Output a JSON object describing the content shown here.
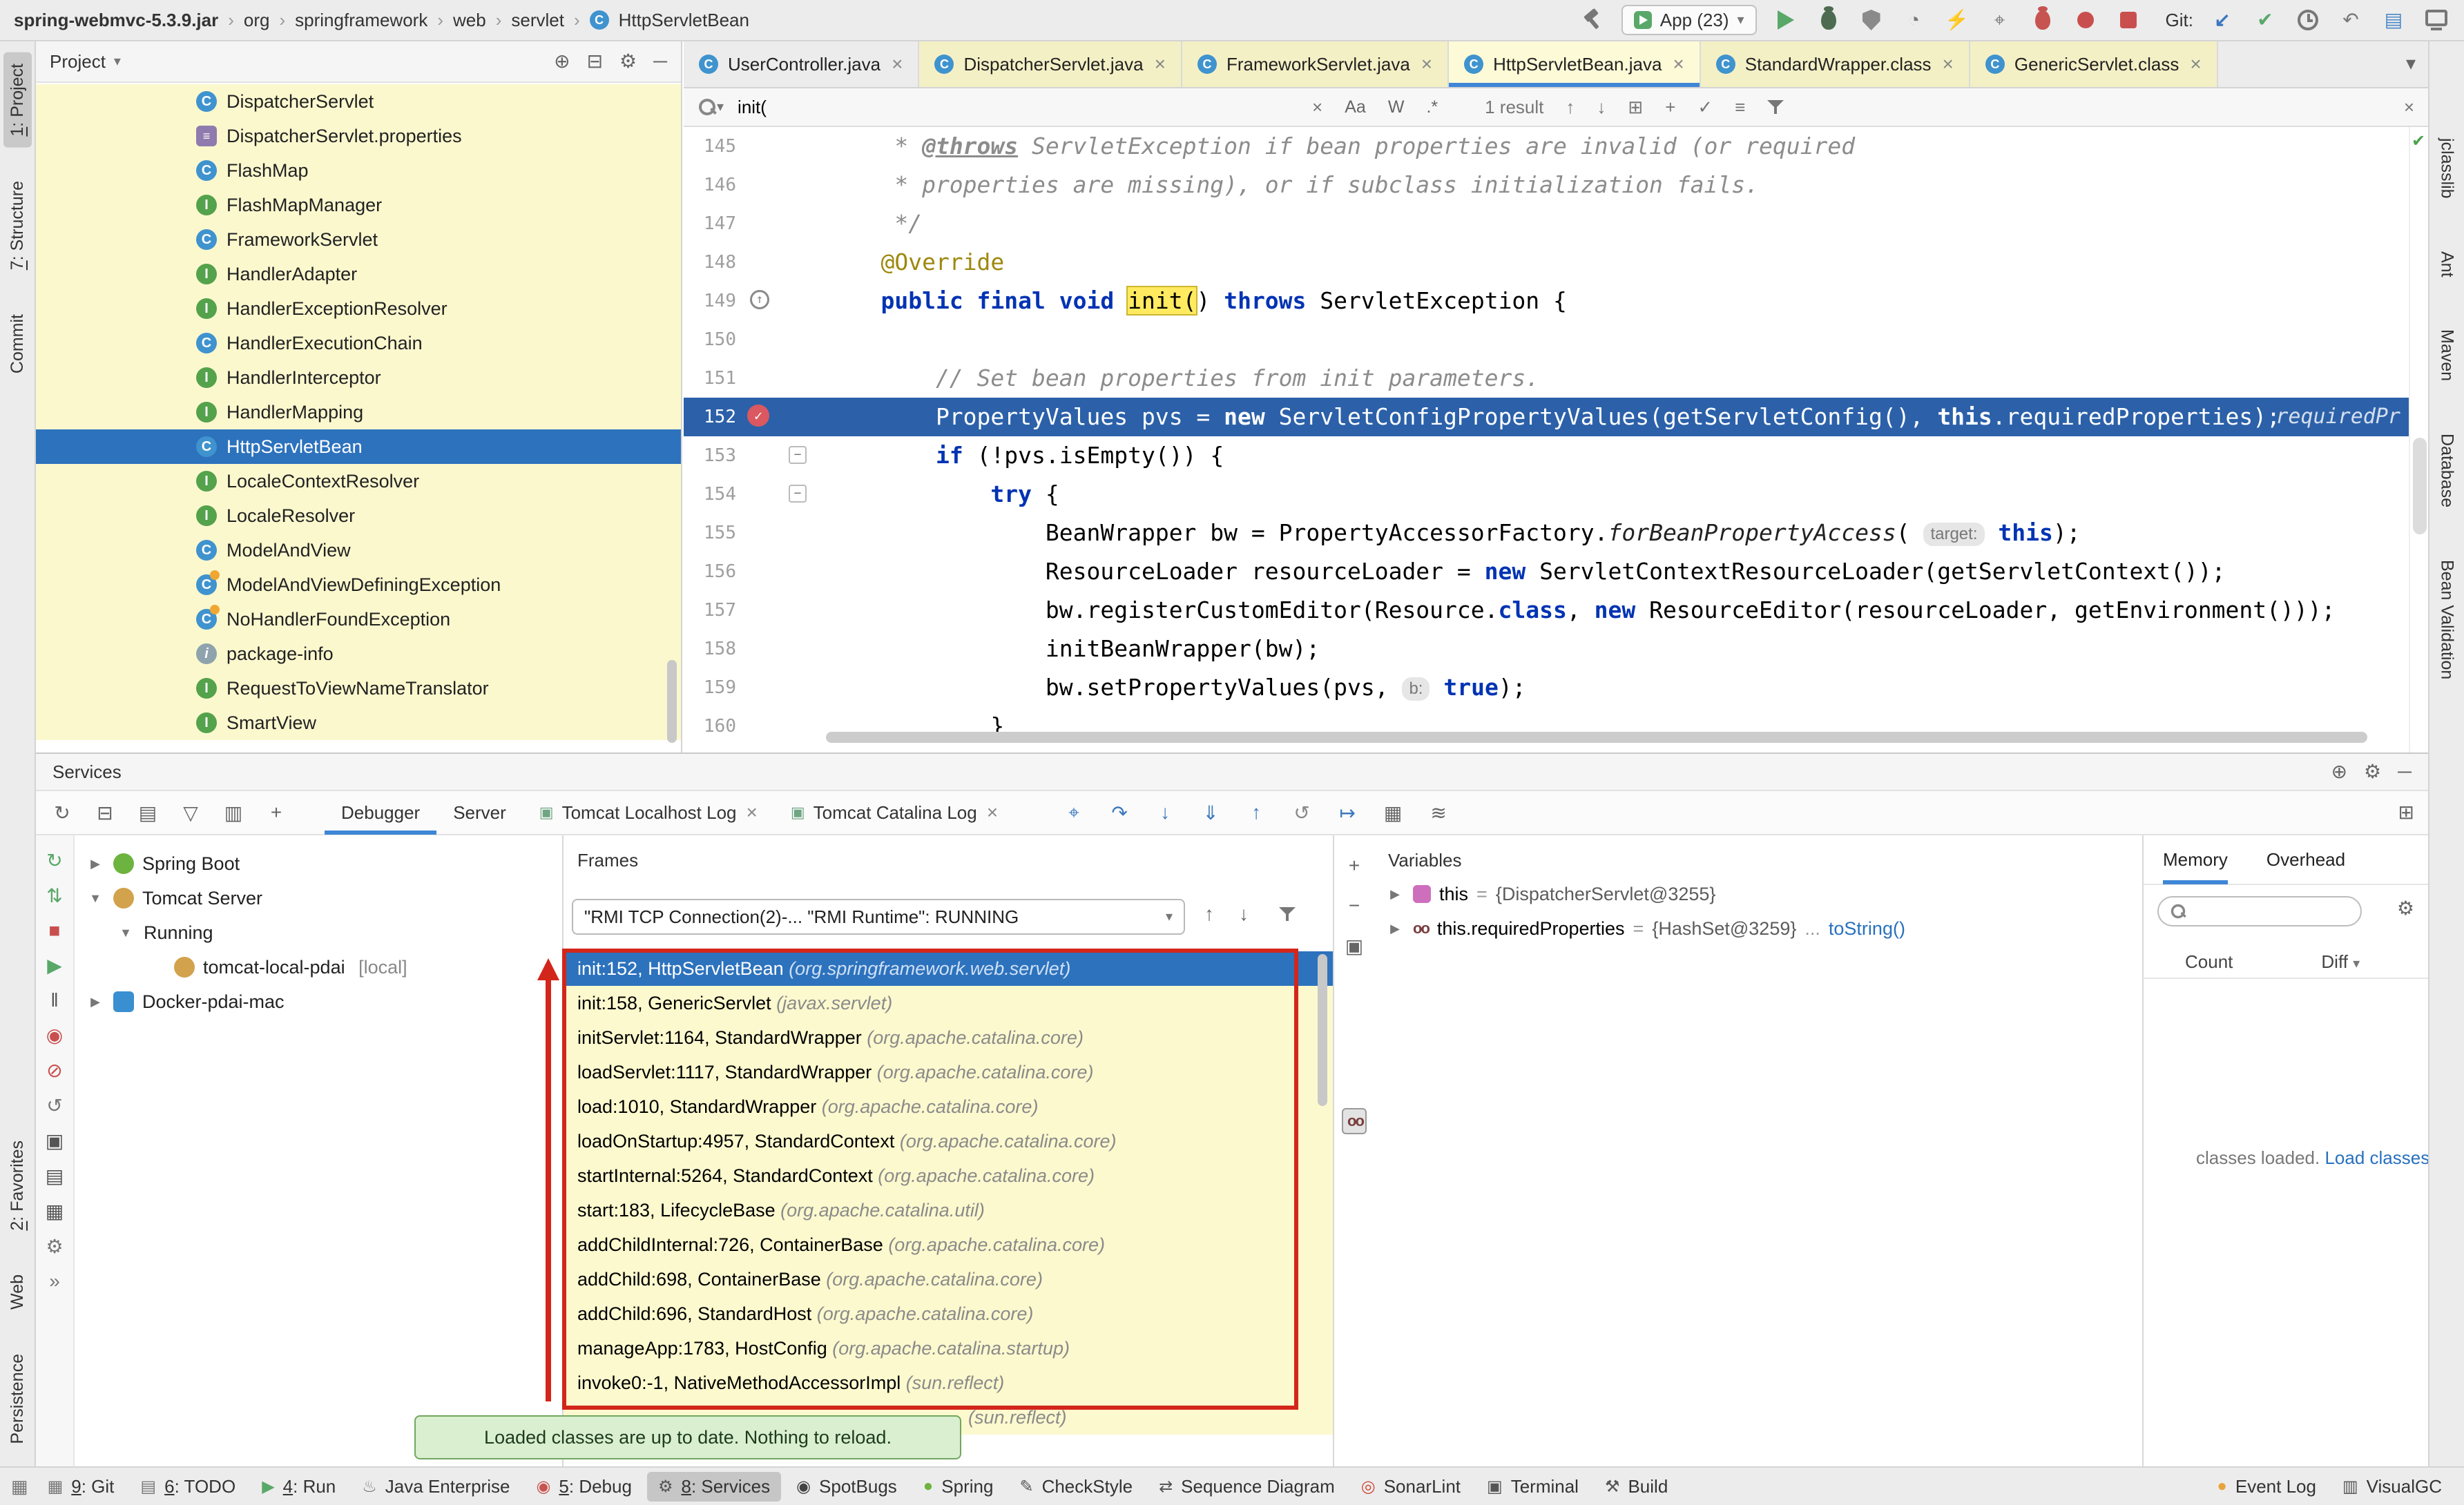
{
  "titlebar": {
    "breadcrumbs": [
      "spring-webmvc-5.3.9.jar",
      "org",
      "springframework",
      "web",
      "servlet",
      "HttpServletBean"
    ],
    "run_config_label": "App (23)",
    "git_label": "Git:"
  },
  "left_strip": {
    "top": [
      {
        "label": "1: Project",
        "active": true
      },
      {
        "label": "7: Structure"
      },
      {
        "label": "Commit"
      }
    ],
    "bottom": [
      {
        "label": "2: Favorites"
      },
      {
        "label": "Web"
      },
      {
        "label": "Persistence"
      }
    ]
  },
  "right_strip": [
    "jclasslib",
    "Ant",
    "Maven",
    "Database",
    "Bean Validation"
  ],
  "project_panel": {
    "title": "Project",
    "items": [
      {
        "label": "DispatcherServlet",
        "icon": "class"
      },
      {
        "label": "DispatcherServlet.properties",
        "icon": "properties"
      },
      {
        "label": "FlashMap",
        "icon": "class"
      },
      {
        "label": "FlashMapManager",
        "icon": "interface"
      },
      {
        "label": "FrameworkServlet",
        "icon": "class"
      },
      {
        "label": "HandlerAdapter",
        "icon": "interface"
      },
      {
        "label": "HandlerExceptionResolver",
        "icon": "interface"
      },
      {
        "label": "HandlerExecutionChain",
        "icon": "class"
      },
      {
        "label": "HandlerInterceptor",
        "icon": "interface"
      },
      {
        "label": "HandlerMapping",
        "icon": "interface"
      },
      {
        "label": "HttpServletBean",
        "icon": "class",
        "selected": true
      },
      {
        "label": "LocaleContextResolver",
        "icon": "interface"
      },
      {
        "label": "LocaleResolver",
        "icon": "interface"
      },
      {
        "label": "ModelAndView",
        "icon": "class"
      },
      {
        "label": "ModelAndViewDefiningException",
        "icon": "exception"
      },
      {
        "label": "NoHandlerFoundException",
        "icon": "exception"
      },
      {
        "label": "package-info",
        "icon": "package-info"
      },
      {
        "label": "RequestToViewNameTranslator",
        "icon": "interface"
      },
      {
        "label": "SmartView",
        "icon": "interface"
      }
    ]
  },
  "editor": {
    "tabs": [
      {
        "label": "UserController.java",
        "kind": "plain"
      },
      {
        "label": "DispatcherServlet.java",
        "kind": "lib"
      },
      {
        "label": "FrameworkServlet.java",
        "kind": "lib"
      },
      {
        "label": "HttpServletBean.java",
        "kind": "lib",
        "active": true
      },
      {
        "label": "StandardWrapper.class",
        "kind": "lib"
      },
      {
        "label": "GenericServlet.class",
        "kind": "lib"
      }
    ],
    "find": {
      "query": "init(",
      "match_case": "Aa",
      "words": "W",
      "regex": ".*",
      "results": "1 result"
    },
    "code": {
      "lines": [
        {
          "num": 145,
          "segs": [
            [
              "doc",
              "     * "
            ],
            [
              "doctag",
              "@throws"
            ],
            [
              "doc",
              " ServletException if bean properties are invalid (or required"
            ]
          ]
        },
        {
          "num": 146,
          "segs": [
            [
              "doc",
              "     * properties are missing), or if subclass initialization fails."
            ]
          ]
        },
        {
          "num": 147,
          "segs": [
            [
              "doc",
              "     */"
            ]
          ]
        },
        {
          "num": 148,
          "segs": [
            [
              "ann",
              "    @Override"
            ]
          ]
        },
        {
          "num": 149,
          "gutter": "override",
          "segs": [
            [
              "pl",
              "    "
            ],
            [
              "kw",
              "public final void "
            ],
            [
              "hl",
              "init("
            ],
            [
              "pl",
              ") "
            ],
            [
              "kw",
              "throws"
            ],
            [
              "pl",
              " ServletException {"
            ]
          ]
        },
        {
          "num": 150,
          "segs": []
        },
        {
          "num": 151,
          "segs": [
            [
              "cmt",
              "        // Set bean properties from init parameters."
            ]
          ]
        },
        {
          "num": 152,
          "exec": true,
          "gutter": "breakpoint",
          "hint_right": "requiredPr",
          "segs": [
            [
              "pl",
              "        PropertyValues pvs = "
            ],
            [
              "kw",
              "new"
            ],
            [
              "pl",
              " ServletConfigPropertyValues(getServletConfig(), "
            ],
            [
              "kw",
              "this"
            ],
            [
              "pl",
              ".requiredProperties);"
            ]
          ]
        },
        {
          "num": 153,
          "fold": true,
          "segs": [
            [
              "pl",
              "        "
            ],
            [
              "kw",
              "if"
            ],
            [
              "pl",
              " (!pvs.isEmpty()) {"
            ]
          ]
        },
        {
          "num": 154,
          "fold": true,
          "segs": [
            [
              "pl",
              "            "
            ],
            [
              "kw",
              "try"
            ],
            [
              "pl",
              " {"
            ]
          ]
        },
        {
          "num": 155,
          "segs": [
            [
              "pl",
              "                BeanWrapper bw = PropertyAccessorFactory."
            ],
            [
              "it",
              "forBeanPropertyAccess"
            ],
            [
              "pl",
              "( "
            ],
            [
              "chip",
              "target:"
            ],
            [
              "pl",
              " "
            ],
            [
              "kw",
              "this"
            ],
            [
              "pl",
              ");"
            ]
          ]
        },
        {
          "num": 156,
          "segs": [
            [
              "pl",
              "                ResourceLoader resourceLoader = "
            ],
            [
              "kw",
              "new"
            ],
            [
              "pl",
              " ServletContextResourceLoader(getServletContext());"
            ]
          ]
        },
        {
          "num": 157,
          "segs": [
            [
              "pl",
              "                bw.registerCustomEditor(Resource."
            ],
            [
              "kw",
              "class"
            ],
            [
              "pl",
              ", "
            ],
            [
              "kw",
              "new"
            ],
            [
              "pl",
              " ResourceEditor(resourceLoader, getEnvironment()));"
            ]
          ]
        },
        {
          "num": 158,
          "segs": [
            [
              "pl",
              "                initBeanWrapper(bw);"
            ]
          ]
        },
        {
          "num": 159,
          "segs": [
            [
              "pl",
              "                bw.setPropertyValues(pvs, "
            ],
            [
              "chip",
              "b:"
            ],
            [
              "pl",
              " "
            ],
            [
              "kw",
              "true"
            ],
            [
              "pl",
              ");"
            ]
          ]
        },
        {
          "num": 160,
          "segs": [
            [
              "pl",
              "            }"
            ]
          ]
        }
      ]
    }
  },
  "services": {
    "title": "Services",
    "tabs": [
      {
        "label": "Debugger",
        "active": true
      },
      {
        "label": "Server"
      },
      {
        "label": "Tomcat Localhost Log",
        "closable": true
      },
      {
        "label": "Tomcat Catalina Log",
        "closable": true
      }
    ],
    "tree": [
      {
        "label": "Spring Boot",
        "icon": "spring-boot",
        "chevron": "collapsed",
        "indent": 0
      },
      {
        "label": "Tomcat Server",
        "icon": "tomcat",
        "chevron": "expanded",
        "indent": 0
      },
      {
        "label": "Running",
        "chevron": "expanded",
        "indent": 1
      },
      {
        "label": "tomcat-local-pdai",
        "suffix": "[local]",
        "icon": "tomcat",
        "indent": 2
      },
      {
        "label": "Docker-pdai-mac",
        "icon": "docker",
        "chevron": "collapsed",
        "indent": 0
      }
    ],
    "debugger": {
      "frames_title": "Frames",
      "threads_dropdown": "\"RMI TCP Connection(2)-... \"RMI Runtime\": RUNNING",
      "frames": [
        {
          "text": "init:152, HttpServletBean",
          "pkg": "(org.springframework.web.servlet)",
          "selected": true
        },
        {
          "text": "init:158, GenericServlet",
          "pkg": "(javax.servlet)"
        },
        {
          "text": "initServlet:1164, StandardWrapper",
          "pkg": "(org.apache.catalina.core)"
        },
        {
          "text": "loadServlet:1117, StandardWrapper",
          "pkg": "(org.apache.catalina.core)"
        },
        {
          "text": "load:1010, StandardWrapper",
          "pkg": "(org.apache.catalina.core)"
        },
        {
          "text": "loadOnStartup:4957, StandardContext",
          "pkg": "(org.apache.catalina.core)"
        },
        {
          "text": "startInternal:5264, StandardContext",
          "pkg": "(org.apache.catalina.core)"
        },
        {
          "text": "start:183, LifecycleBase",
          "pkg": "(org.apache.catalina.util)"
        },
        {
          "text": "addChildInternal:726, ContainerBase",
          "pkg": "(org.apache.catalina.core)"
        },
        {
          "text": "addChild:698, ContainerBase",
          "pkg": "(org.apache.catalina.core)"
        },
        {
          "text": "addChild:696, StandardHost",
          "pkg": "(org.apache.catalina.core)"
        },
        {
          "text": "manageApp:1783, HostConfig",
          "pkg": "(org.apache.catalina.startup)"
        },
        {
          "text": "invoke0:-1, NativeMethodAccessorImpl",
          "pkg": "(sun.reflect)"
        },
        {
          "text": "",
          "pkg": "(sun.reflect)",
          "cut": true
        }
      ],
      "variables_title": "Variables",
      "variables": [
        {
          "icon": "value",
          "name": "this",
          "value": "{DispatcherServlet@3255}"
        },
        {
          "icon": "watch",
          "name": "this.requiredProperties",
          "value": "{HashSet@3259}",
          "ellipsis": "...",
          "link": "toString()"
        }
      ],
      "memory": {
        "tab1": "Memory",
        "tab2": "Overhead",
        "col_count": "Count",
        "col_diff": "Diff",
        "empty_text": "classes loaded.",
        "load_link": "Load classes"
      }
    },
    "tooltip": "Loaded classes are up to date. Nothing to reload."
  },
  "statusbar": {
    "left": [
      {
        "label": "9: Git",
        "glyph": "▦",
        "color": "#777777"
      },
      {
        "label": "6: TODO",
        "glyph": "▤",
        "color": "#777777"
      },
      {
        "label": "4: Run",
        "glyph": "▶",
        "color": "#59A869"
      },
      {
        "label": "Java Enterprise",
        "glyph": "♨",
        "color": "#777777"
      },
      {
        "label": "5: Debug",
        "glyph": "◉",
        "color": "#C75450"
      },
      {
        "label": "8: Services",
        "glyph": "⚙",
        "color": "#555555",
        "active": true
      },
      {
        "label": "SpotBugs",
        "glyph": "◉",
        "color": "#444444"
      },
      {
        "label": "Spring",
        "glyph": "●",
        "color": "#6DB33F"
      },
      {
        "label": "CheckStyle",
        "glyph": "✎",
        "color": "#555555"
      },
      {
        "label": "Sequence Diagram",
        "glyph": "⇄",
        "color": "#555555"
      },
      {
        "label": "SonarLint",
        "glyph": "◎",
        "color": "#CC4B38"
      },
      {
        "label": "Terminal",
        "glyph": "▣",
        "color": "#555555"
      },
      {
        "label": "Build",
        "glyph": "⚒",
        "color": "#555555"
      }
    ],
    "right": [
      {
        "label": "Event Log",
        "glyph": "●",
        "color": "#E8A33D"
      },
      {
        "label": "VisualGC",
        "glyph": "▥",
        "color": "#555555"
      }
    ]
  },
  "toolbars": {
    "services_side": [
      {
        "name": "rerun",
        "glyph": "↻",
        "color": "#59A869"
      },
      {
        "name": "update-application",
        "glyph": "⇅",
        "color": "#59A869"
      },
      {
        "name": "stop",
        "glyph": "■",
        "color": "#C94F4F"
      },
      {
        "name": "resume",
        "glyph": "▶",
        "color": "#59A869"
      },
      {
        "name": "pause",
        "glyph": "‖",
        "color": "#555555"
      },
      {
        "name": "view-breakpoints",
        "glyph": "◉",
        "color": "#C94F4F"
      },
      {
        "name": "mute-breakpoints",
        "glyph": "⊘",
        "color": "#C94F4F"
      },
      {
        "name": "restore-layout",
        "glyph": "↺",
        "color": "#777777"
      },
      {
        "name": "thread-dump",
        "glyph": "▣",
        "color": "#555555"
      },
      {
        "name": "memory-view",
        "glyph": "▤",
        "color": "#555555"
      },
      {
        "name": "evaluate",
        "glyph": "▦",
        "color": "#555555"
      },
      {
        "name": "settings",
        "glyph": "⚙",
        "color": "#777777"
      },
      {
        "name": "more",
        "glyph": "»",
        "color": "#777777"
      }
    ],
    "services_toolbar": [
      {
        "name": "refresh-services",
        "glyph": "↻",
        "color": "#666666"
      },
      {
        "name": "collapse-all",
        "glyph": "⊟",
        "color": "#666666"
      },
      {
        "name": "group-by",
        "glyph": "▤",
        "color": "#666666"
      },
      {
        "name": "filter",
        "glyph": "▽",
        "color": "#666666"
      },
      {
        "name": "split-view",
        "glyph": "▥",
        "color": "#666666"
      },
      {
        "name": "add-service",
        "glyph": "+",
        "color": "#666666"
      }
    ],
    "debug_toolbar": [
      {
        "name": "show-execution-point",
        "glyph": "⌖",
        "color": "#3B78BE"
      },
      {
        "name": "step-over",
        "glyph": "↷",
        "color": "#3B78BE"
      },
      {
        "name": "step-into",
        "glyph": "↓",
        "color": "#3B78BE"
      },
      {
        "name": "force-step-into",
        "glyph": "⇓",
        "color": "#3B78BE"
      },
      {
        "name": "step-out",
        "glyph": "↑",
        "color": "#3B78BE"
      },
      {
        "name": "drop-frame",
        "glyph": "↺",
        "color": "#888888"
      },
      {
        "name": "run-to-cursor",
        "glyph": "↦",
        "color": "#3B78BE"
      },
      {
        "name": "evaluate-expression",
        "glyph": "▦",
        "color": "#666666"
      },
      {
        "name": "settings-sliders",
        "glyph": "≋",
        "color": "#666666"
      }
    ],
    "vars_toolbar": [
      {
        "name": "new-watch",
        "glyph": "+",
        "color": "#666666"
      },
      {
        "name": "remove-watch",
        "glyph": "−",
        "color": "#666666"
      },
      {
        "name": "copy-value",
        "glyph": "▣",
        "color": "#666666"
      },
      {
        "name": "show-watches",
        "glyph": "oo",
        "color": "#7A3E3E",
        "pressed": true
      }
    ]
  },
  "icons": {
    "caret-down": "▾",
    "hidden-tabs": "▾",
    "sort-down": "▾",
    "clear": "×",
    "close": "×",
    "prev": "↑",
    "next": "↓",
    "open-find-window": "⊞",
    "add-occurrence": "+",
    "select-occurrences": "✓",
    "filter-lines": "≡",
    "locate": "⊕",
    "collapse": "⊟",
    "gear": "⚙",
    "hide": "─",
    "profiler": "◔",
    "snapshot": "⚡",
    "attach": "⌖",
    "git-update": "↙",
    "git-commit": "✔",
    "rollback": "↶",
    "jclasslib": "▤",
    "layout": "⊞",
    "switcher": "▦",
    "check": "✔"
  }
}
